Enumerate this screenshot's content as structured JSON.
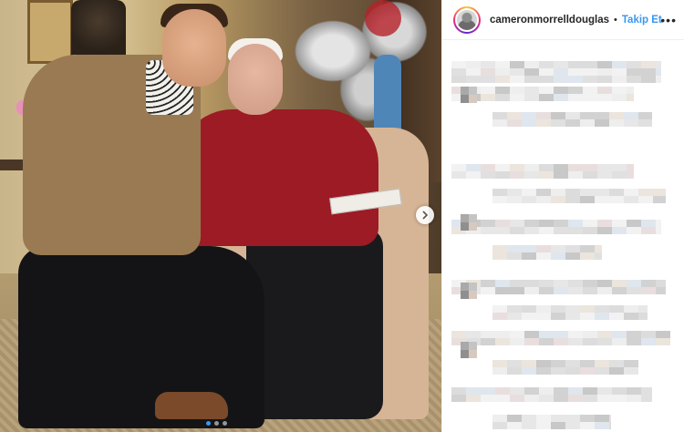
{
  "post": {
    "account": {
      "username": "cameronmorrelldouglas",
      "separator": "•",
      "follow_label": "Takip Et",
      "more_icon": "more-options-icon"
    },
    "carousel": {
      "next_icon": "chevron-right-icon",
      "slides": 3,
      "active_slide": 1
    },
    "colors": {
      "accent": "#3897f0",
      "text": "#262626",
      "border": "#efefef"
    }
  }
}
